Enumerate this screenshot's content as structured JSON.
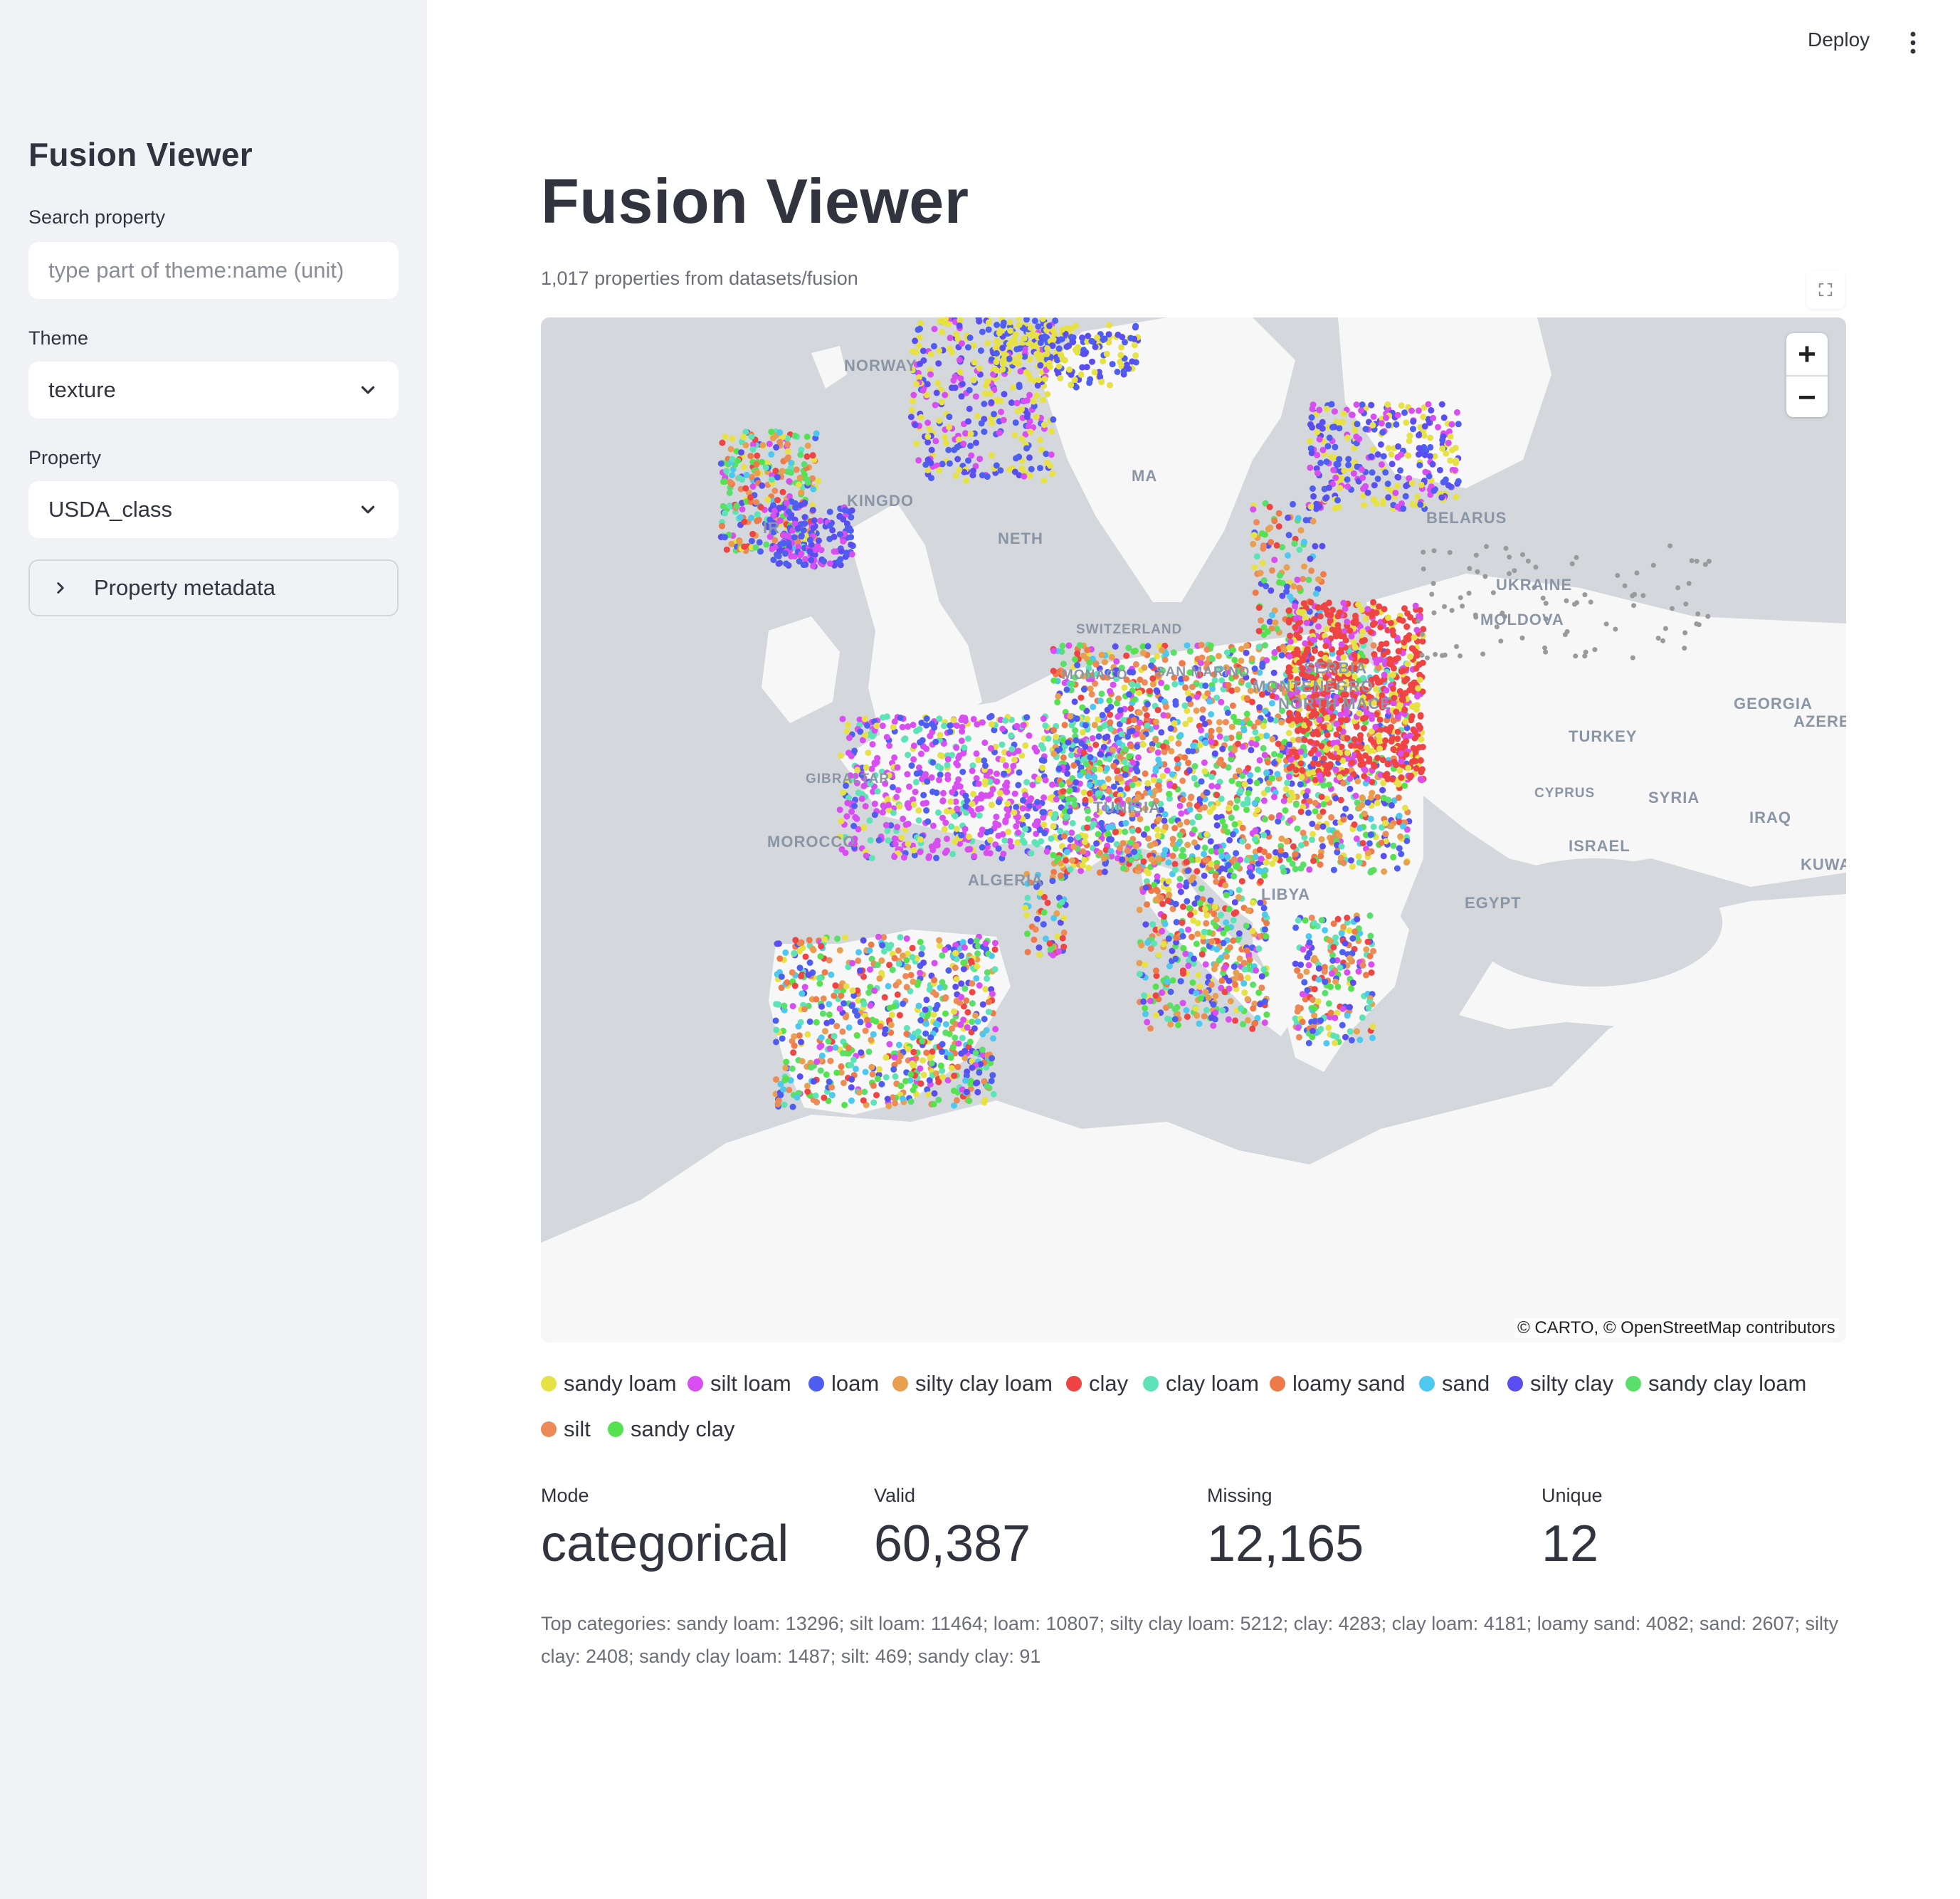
{
  "sidebar": {
    "title": "Fusion Viewer",
    "search": {
      "label": "Search property",
      "placeholder": "type part of theme:name (unit)",
      "value": ""
    },
    "theme": {
      "label": "Theme",
      "value": "texture"
    },
    "property": {
      "label": "Property",
      "value": "USDA_class"
    },
    "metadata_expander": "Property metadata"
  },
  "header": {
    "deploy": "Deploy"
  },
  "main": {
    "title": "Fusion Viewer",
    "caption": "1,017 properties from datasets/fusion",
    "attribution": "© CARTO, © OpenStreetMap contributors",
    "map_labels": [
      "NORWAY",
      "BELARUS",
      "UKRAINE",
      "KINGDO",
      "NETH",
      "IR",
      "MA",
      "MOLDOVA",
      "SERBIA",
      "MONTENEGRO",
      "NORTH MACE",
      "GEORGIA",
      "AZERBA",
      "TURKEY",
      "SYRIA",
      "IRAQ",
      "ISRAEL",
      "KUWA",
      "TUNISIA",
      "MOROCCO",
      "ALGERIA",
      "LIBYA",
      "EGYPT",
      "GIBRALTAR",
      "MONACO",
      "SAN MARINO",
      "CYPRUS",
      "SWITZERLAND"
    ]
  },
  "legend": [
    {
      "label": "sandy loam",
      "color": "#e6e246"
    },
    {
      "label": "silt loam",
      "color": "#d94ef0"
    },
    {
      "label": "loam",
      "color": "#4e5ef0"
    },
    {
      "label": "silty clay loam",
      "color": "#e8a050"
    },
    {
      "label": "clay",
      "color": "#ee4444"
    },
    {
      "label": "clay loam",
      "color": "#5ee3b8"
    },
    {
      "label": "loamy sand",
      "color": "#ee7a4a"
    },
    {
      "label": "sand",
      "color": "#4ec8ee"
    },
    {
      "label": "silty clay",
      "color": "#5b4ef0"
    },
    {
      "label": "sandy clay loam",
      "color": "#5ae06a"
    },
    {
      "label": "silt",
      "color": "#ec8a58"
    },
    {
      "label": "sandy clay",
      "color": "#56e24e"
    }
  ],
  "metrics": [
    {
      "label": "Mode",
      "value": "categorical"
    },
    {
      "label": "Valid",
      "value": "60,387"
    },
    {
      "label": "Missing",
      "value": "12,165"
    },
    {
      "label": "Unique",
      "value": "12"
    }
  ],
  "top_categories": "Top categories: sandy loam: 13296; silt loam: 11464; loam: 10807; silty clay loam: 5212; clay: 4283; clay loam: 4181; loamy sand: 4082; sand: 2607; silty clay: 2408; sandy clay loam: 1487; silt: 469; sandy clay: 91"
}
